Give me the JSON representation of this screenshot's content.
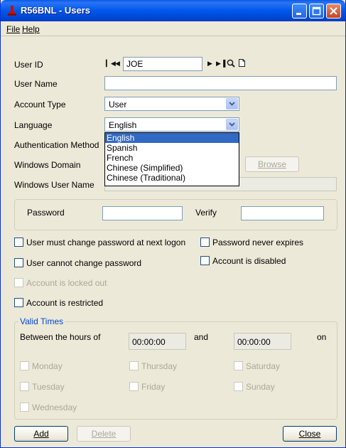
{
  "window": {
    "title": "R56BNL - Users",
    "colors": {
      "titlebar": "#0058e8",
      "accent": "#0046d5",
      "selection": "#316ac5"
    }
  },
  "menu": {
    "file": "File",
    "help": "Help"
  },
  "form": {
    "user_id_label": "User ID",
    "user_id_value": "JOE",
    "user_name_label": "User Name",
    "user_name_value": "",
    "account_type_label": "Account Type",
    "account_type_value": "User",
    "language_label": "Language",
    "language_value": "English",
    "language_options": [
      "English",
      "Spanish",
      "French",
      "Chinese (Simplified)",
      "Chinese (Traditional)"
    ],
    "auth_method_label": "Authentication Method",
    "windows_domain_label": "Windows Domain",
    "browse_button": "Browse",
    "windows_user_label": "Windows User Name",
    "password_label": "Password",
    "verify_label": "Verify"
  },
  "checkboxes": {
    "must_change": "User must change password at next logon",
    "never_expires": "Password never expires",
    "cannot_change": "User cannot change password",
    "disabled": "Account is disabled",
    "locked_out": "Account is locked out",
    "restricted": "Account is restricted"
  },
  "valid_times": {
    "title": "Valid Times",
    "between_label": "Between the hours of",
    "start_time": "00:00:00",
    "and_label": "and",
    "end_time": "00:00:00",
    "on_label": "on",
    "days": {
      "monday": "Monday",
      "tuesday": "Tuesday",
      "wednesday": "Wednesday",
      "thursday": "Thursday",
      "friday": "Friday",
      "saturday": "Saturday",
      "sunday": "Sunday"
    }
  },
  "buttons": {
    "add": "Add",
    "delete": "Delete",
    "close": "Close"
  }
}
